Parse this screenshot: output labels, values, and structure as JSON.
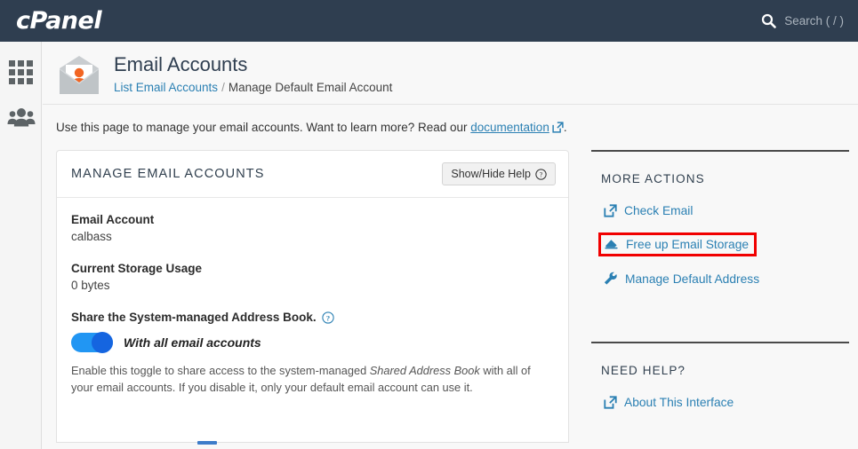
{
  "header": {
    "logo_text": "cPanel",
    "search_placeholder": "Search ( / )",
    "search_icon": "search-icon"
  },
  "sidebar": {
    "items": [
      {
        "icon": "apps-grid-icon",
        "label": "Apps"
      },
      {
        "icon": "users-group-icon",
        "label": "User Manager"
      }
    ]
  },
  "page": {
    "icon": "email-accounts-envelope-icon",
    "title": "Email Accounts",
    "breadcrumb": {
      "link_text": "List Email Accounts",
      "separator": "/",
      "current": "Manage Default Email Account"
    },
    "intro_before": "Use this page to manage your email accounts. Want to learn more? Read our",
    "intro_link": "documentation",
    "intro_after": "."
  },
  "panel": {
    "title": "MANAGE EMAIL ACCOUNTS",
    "help_button": "Show/Hide Help",
    "help_button_icon": "question-circle-icon",
    "fields": [
      {
        "label": "Email Account",
        "value": "calbass"
      },
      {
        "label": "Current Storage Usage",
        "value": "0 bytes"
      }
    ],
    "toggle": {
      "label": "Share the System-managed Address Book.",
      "label_icon": "question-circle-icon",
      "state_text": "With all email accounts",
      "enabled": true,
      "description_part1": "Enable this toggle to share access to the system-managed",
      "description_emphasis": "Shared Address Book",
      "description_part2": "with all of your email accounts. If you disable it, only your default email account can use it."
    }
  },
  "more_actions": {
    "title": "MORE ACTIONS",
    "links": [
      {
        "label": "Check Email",
        "icon": "external-link-icon",
        "highlighted": false
      },
      {
        "label": "Free up Email Storage",
        "icon": "eraser-icon",
        "highlighted": true
      },
      {
        "label": "Manage Default Address",
        "icon": "wrench-icon",
        "highlighted": false
      }
    ]
  },
  "need_help": {
    "title": "NEED HELP?",
    "links": [
      {
        "label": "About This Interface",
        "icon": "external-link-icon"
      }
    ]
  },
  "colors": {
    "header_bg": "#2f3e50",
    "link_blue": "#2b80b3",
    "accent_orange": "#f26522",
    "toggle_blue": "#2196f3",
    "highlight_red": "#f10000"
  }
}
